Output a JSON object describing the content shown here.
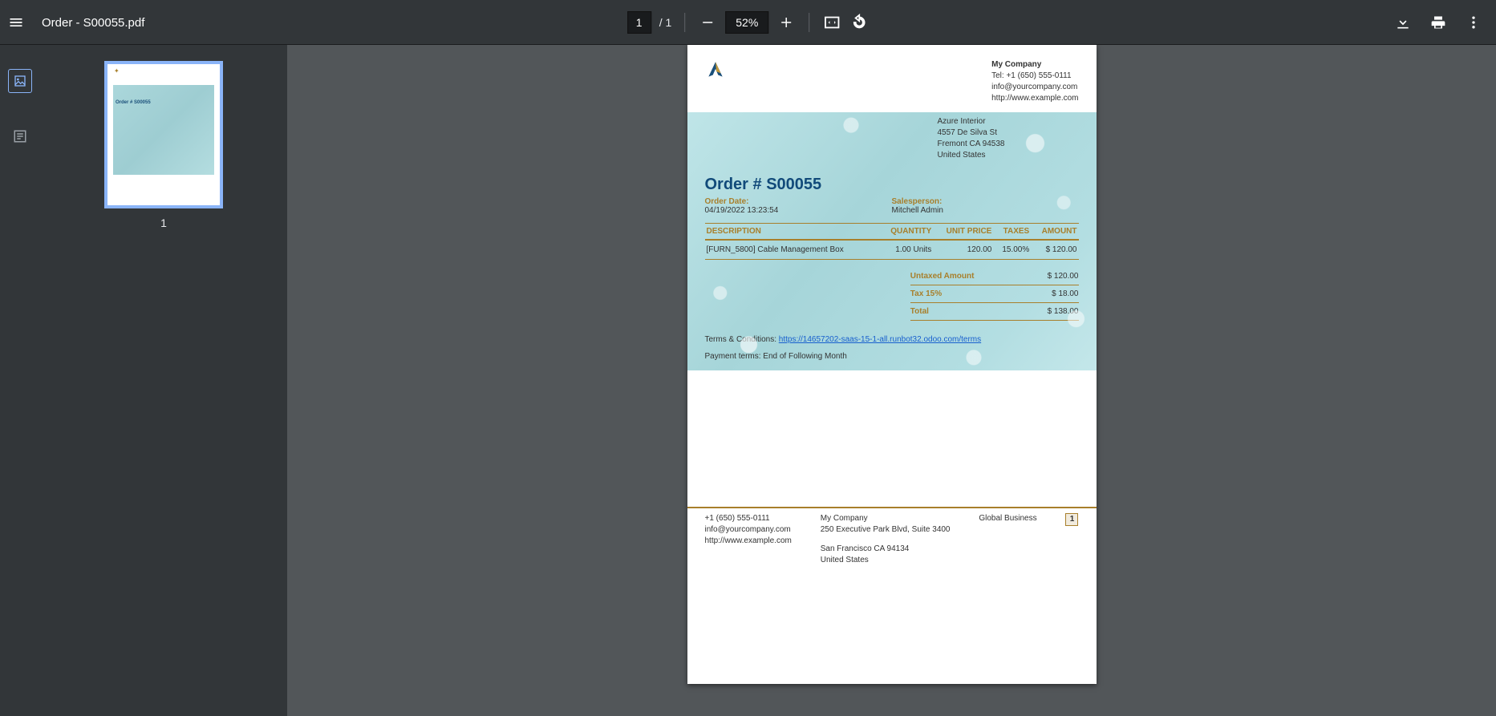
{
  "toolbar": {
    "title": "Order - S00055.pdf",
    "page_current": "1",
    "page_total": "1",
    "zoom": "52%"
  },
  "thumbnail": {
    "index": "1"
  },
  "doc": {
    "company": {
      "name": "My Company",
      "tel": "Tel: +1 (650) 555-0111",
      "email": "info@yourcompany.com",
      "web": "http://www.example.com"
    },
    "customer": {
      "name": "Azure Interior",
      "street": "4557 De Silva St",
      "citystate": "Fremont CA 94538",
      "country": "United States"
    },
    "order_title": "Order # S00055",
    "order_date_label": "Order Date:",
    "order_date": "04/19/2022 13:23:54",
    "salesperson_label": "Salesperson:",
    "salesperson": "Mitchell Admin",
    "columns": {
      "desc": "DESCRIPTION",
      "qty": "QUANTITY",
      "price": "UNIT PRICE",
      "taxes": "TAXES",
      "amount": "AMOUNT"
    },
    "lines": [
      {
        "desc": "[FURN_5800] Cable Management Box",
        "qty": "1.00 Units",
        "price": "120.00",
        "taxes": "15.00%",
        "amount": "$ 120.00"
      }
    ],
    "totals": {
      "untaxed_label": "Untaxed Amount",
      "untaxed": "$ 120.00",
      "tax_label": "Tax 15%",
      "tax": "$ 18.00",
      "total_label": "Total",
      "total": "$ 138.00"
    },
    "terms_label": "Terms & Conditions: ",
    "terms_url": "https://14657202-saas-15-1-all.runbot32.odoo.com/terms",
    "payment_terms": "Payment terms: End of Following Month",
    "footer": {
      "left_phone": "+1 (650) 555-0111",
      "left_email": "info@yourcompany.com",
      "left_web": "http://www.example.com",
      "mid_name": "My Company",
      "mid_street": "250 Executive Park Blvd, Suite 3400",
      "mid_city": "San Francisco CA 94134",
      "mid_country": "United States",
      "right_biz": "Global Business",
      "page_num": "1"
    }
  }
}
